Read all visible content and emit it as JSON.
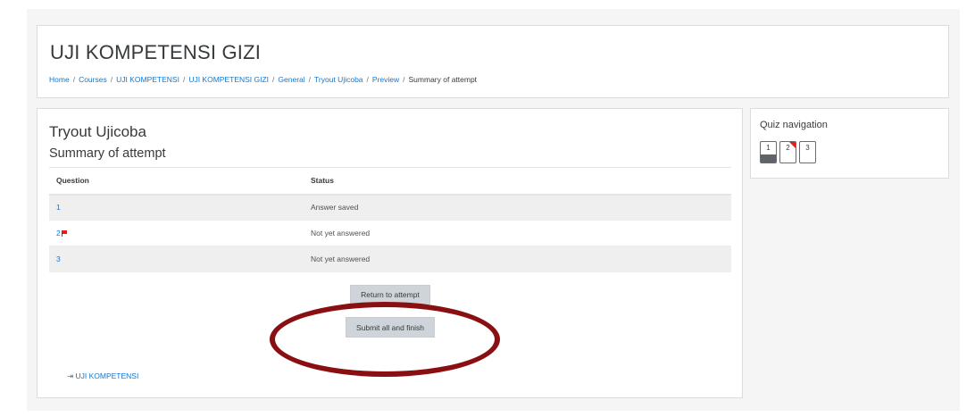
{
  "header": {
    "course_title": "UJI KOMPETENSI GIZI",
    "breadcrumb": [
      "Home",
      "Courses",
      "UJI KOMPETENSI",
      "UJI KOMPETENSI GIZI",
      "General",
      "Tryout Ujicoba",
      "Preview"
    ],
    "breadcrumb_current": "Summary of attempt",
    "breadcrumb_separator": "/"
  },
  "main": {
    "quiz_name": "Tryout Ujicoba",
    "heading": "Summary of attempt",
    "table": {
      "headers": [
        "Question",
        "Status"
      ],
      "rows": [
        {
          "question": "1",
          "status": "Answer saved",
          "flagged": false
        },
        {
          "question": "2",
          "status": "Not yet answered",
          "flagged": true
        },
        {
          "question": "3",
          "status": "Not yet answered",
          "flagged": false
        }
      ]
    },
    "return_button": "Return to attempt",
    "submit_button": "Submit all and finish",
    "back_link": "UJI KOMPETENSI",
    "back_link_icon": "arrow-right-to-bar-icon",
    "highlight_color": "#8a0f12"
  },
  "quiz_navigation": {
    "title": "Quiz navigation",
    "buttons": [
      {
        "label": "1",
        "state": "answered"
      },
      {
        "label": "2",
        "state": "flagged"
      },
      {
        "label": "3",
        "state": "not-answered"
      }
    ]
  },
  "colors": {
    "link": "#1177d1",
    "button_bg": "#ced4da",
    "flag": "#e0201c"
  }
}
